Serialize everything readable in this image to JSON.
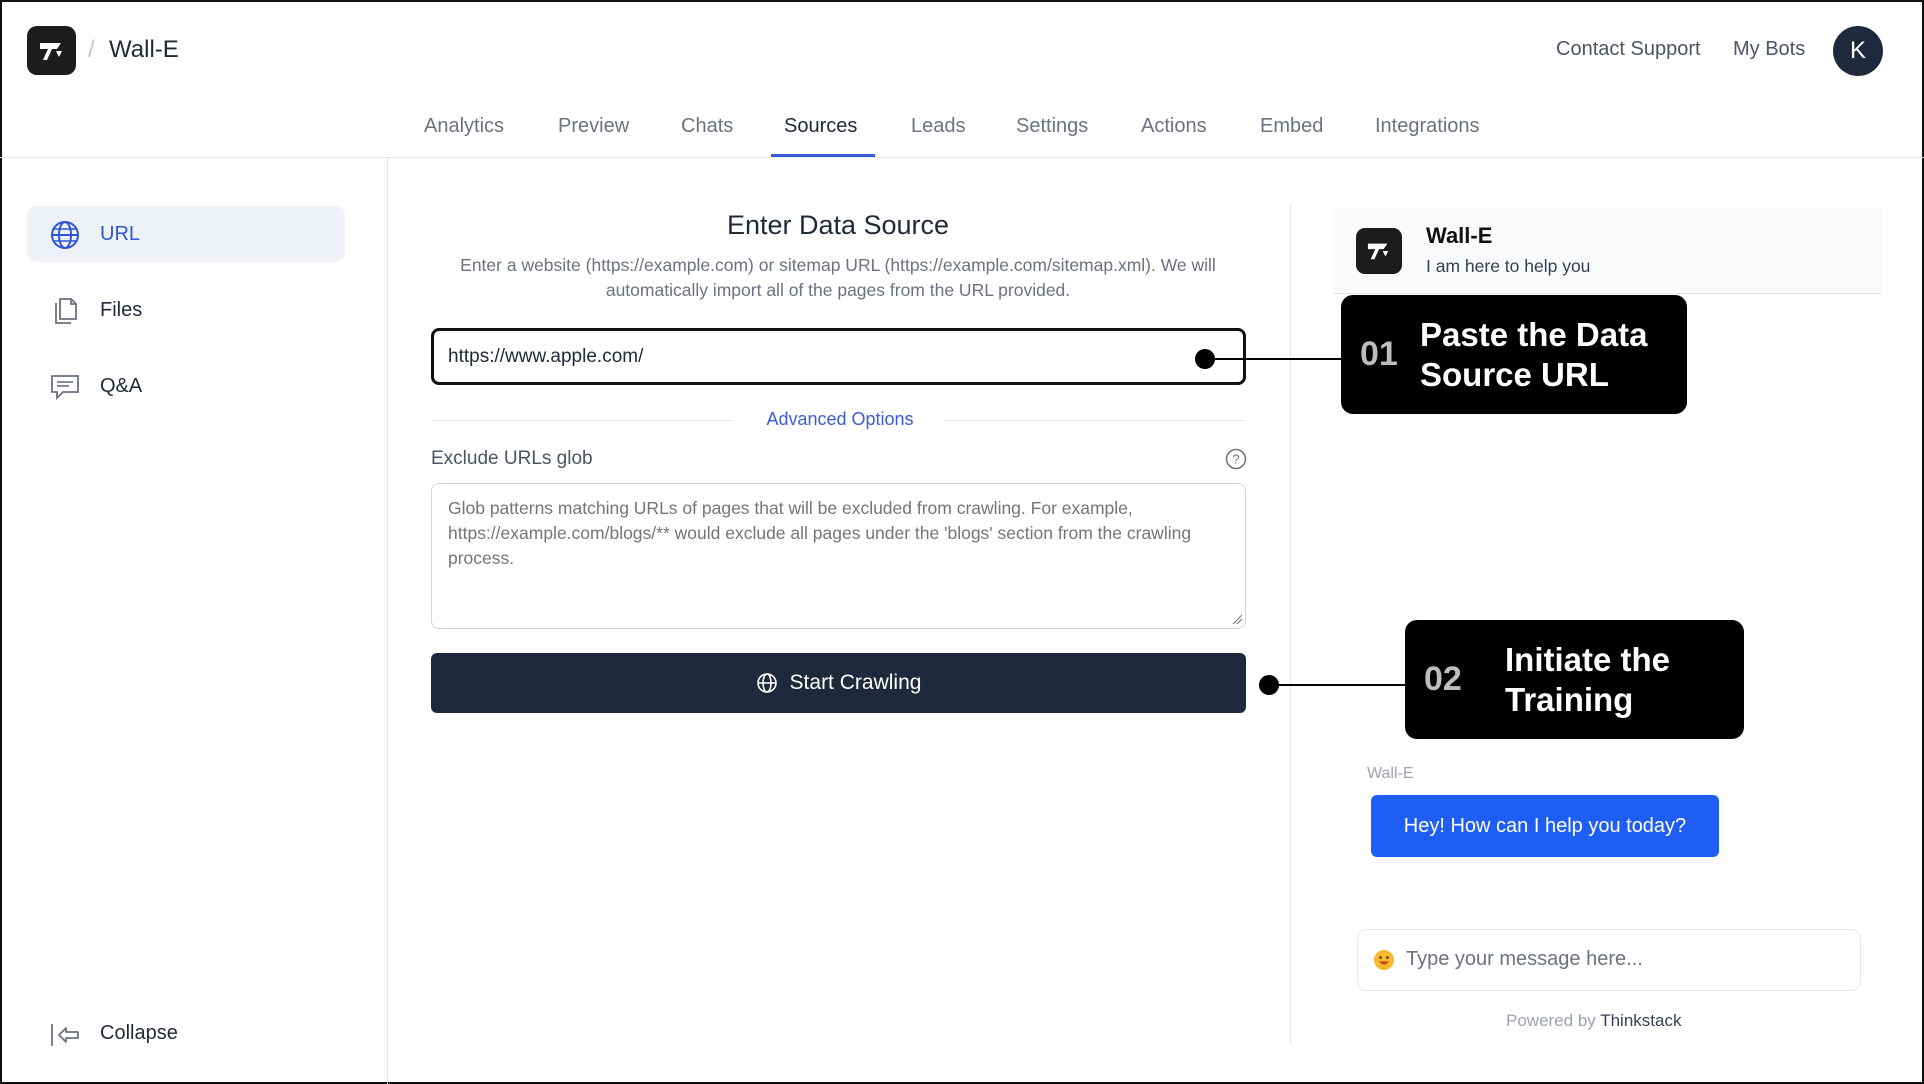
{
  "header": {
    "separator": "/",
    "app_name": "Wall-E",
    "contact_support": "Contact Support",
    "my_bots": "My Bots",
    "avatar_initial": "K"
  },
  "tabs": [
    {
      "label": "Analytics"
    },
    {
      "label": "Preview"
    },
    {
      "label": "Chats"
    },
    {
      "label": "Sources",
      "active": true
    },
    {
      "label": "Leads"
    },
    {
      "label": "Settings"
    },
    {
      "label": "Actions"
    },
    {
      "label": "Embed"
    },
    {
      "label": "Integrations"
    }
  ],
  "sidebar": {
    "items": [
      {
        "label": "URL",
        "icon": "globe-icon",
        "active": true
      },
      {
        "label": "Files",
        "icon": "files-icon"
      },
      {
        "label": "Q&A",
        "icon": "qa-chat-icon"
      }
    ],
    "collapse_label": "Collapse"
  },
  "main": {
    "title": "Enter Data Source",
    "description": "Enter a website (https://example.com) or sitemap URL (https://example.com/sitemap.xml). We will automatically import all of the pages from the URL provided.",
    "url_value": "https://www.apple.com/",
    "advanced_options": "Advanced Options",
    "exclude_label": "Exclude URLs glob",
    "exclude_placeholder": "Glob patterns matching URLs of pages that will be excluded from crawling. For example, https://example.com/blogs/** would exclude all pages under the 'blogs' section from the crawling process.",
    "start_button": "Start Crawling"
  },
  "chat": {
    "bot_name": "Wall-E",
    "subtitle": "I am here to help you",
    "message_sender": "Wall-E",
    "message": "Hey! How can I help you today?",
    "input_placeholder": "Type your message here...",
    "powered_prefix": "Powered by",
    "powered_brand": "Thinkstack"
  },
  "callouts": [
    {
      "number": "01",
      "text_line1": "Paste the Data",
      "text_line2": "Source URL"
    },
    {
      "number": "02",
      "text_line1": "Initiate the",
      "text_line2": "Training"
    }
  ],
  "colors": {
    "accent": "#3b5bdb",
    "button_dark": "#1e293b",
    "bubble_blue": "#1f5ef5"
  }
}
